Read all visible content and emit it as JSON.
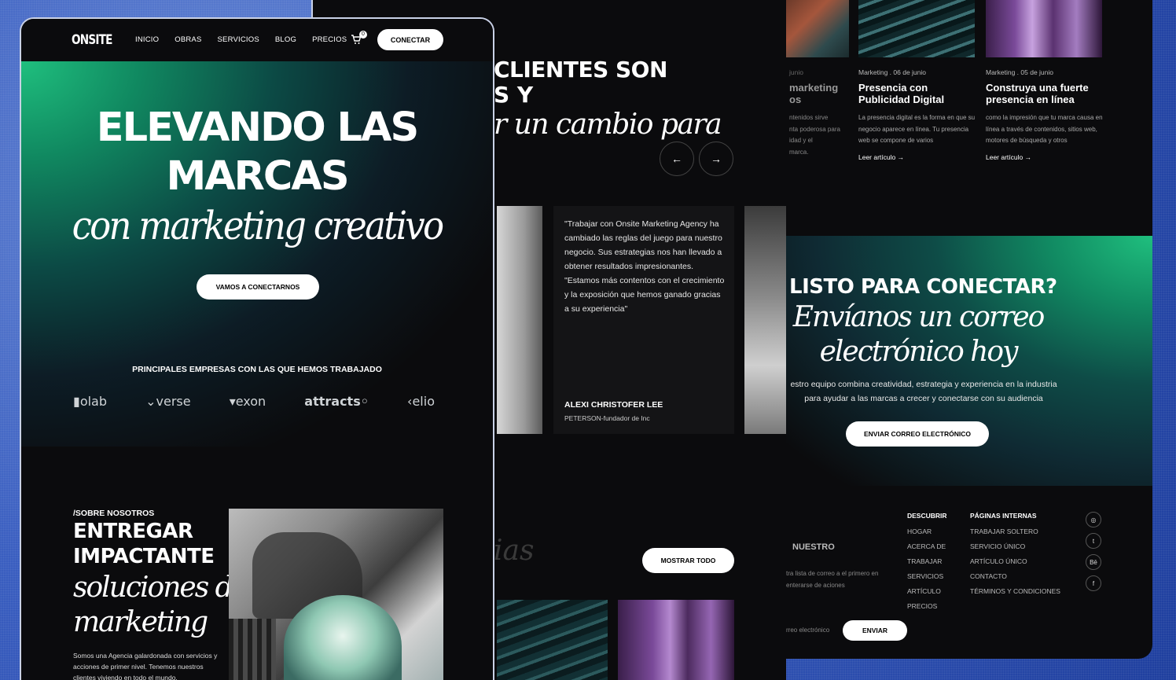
{
  "left": {
    "logo": "ONSITE",
    "menu": [
      "INICIO",
      "OBRAS",
      "SERVICIOS",
      "BLOG",
      "PRECIOS"
    ],
    "cart_count": "0",
    "connect_button": "CONECTAR",
    "hero_line1": "ELEVANDO LAS",
    "hero_line2": "MARCAS",
    "hero_script": "con marketing creativo",
    "hero_cta": "VAMOS A CONECTARNOS",
    "companies_title": "PRINCIPALES EMPRESAS CON LAS QUE HEMOS TRABAJADO",
    "brands": [
      "olab",
      "verse",
      "exon",
      "attracts",
      "elio"
    ],
    "about_label": "/SOBRE NOSOTROS",
    "about_title_1": "ENTREGAR",
    "about_title_2": "IMPACTANTE",
    "about_script_1": "soluciones de",
    "about_script_2": "marketing",
    "about_body": "Somos una Agencia galardonada con servicios y acciones de primer nivel. Tenemos nuestros clientes viviendo en todo el mundo."
  },
  "middle": {
    "title_1": "CLIENTES SON",
    "title_2": "S Y",
    "title_3": "r un cambio para",
    "prev_icon": "arrow-left-icon",
    "next_icon": "arrow-right-icon",
    "quote": "\"Trabajar con Onsite Marketing Agency ha cambiado las reglas del juego para nuestro negocio. Sus estrategias nos han llevado a obtener resultados impresionantes. \"Estamos más contentos con el crecimiento y la exposición que hemos ganado gracias a su experiencia\"",
    "author": "ALEXI CHRISTOFER LEE",
    "role": "PETERSON-fundador de Inc",
    "faded_script": "ias",
    "show_all": "MOSTRAR TODO"
  },
  "right": {
    "frag_meta": "junio",
    "frag_title_1": "marketing",
    "frag_title_2": "os",
    "frag_body": [
      "ntenidos sirve",
      "nta poderosa para",
      "idad y el",
      "marca."
    ],
    "posts": [
      {
        "meta": "Marketing . 06 de junio",
        "title": "Presencia con Publicidad Digital",
        "body": "La presencia digital es la forma en que su negocio aparece en línea. Tu presencia web se compone de varios",
        "read": "Leer artículo"
      },
      {
        "meta": "Marketing . 05 de junio",
        "title": "Construya una fuerte presencia en línea",
        "body": "como la impresión que tu marca causa en línea a través de contenidos, sitios web, motores de búsqueda y otros",
        "read": "Leer artículo"
      }
    ],
    "cta_title": "LISTO PARA CONECTAR?",
    "cta_script_1": "Envíanos un correo",
    "cta_script_2": "electrónico hoy",
    "cta_body_1": "estro equipo combina creatividad, estrategia y experiencia en la industria",
    "cta_body_2": "para ayudar a las marcas a crecer y conectarse con su audiencia",
    "cta_button": "ENVIAR CORREO ELECTRÓNICO",
    "newsletter_title": "NUESTRO",
    "newsletter_body": "tra lista de correo a el primero en enterarse de aciones",
    "email_placeholder": "rreo electrónico",
    "send_button": "ENVIAR",
    "discover_title": "DESCUBRIR",
    "discover_links": [
      "HOGAR",
      "ACERCA DE",
      "TRABAJAR",
      "SERVICIOS",
      "ARTÍCULO",
      "PRECIOS"
    ],
    "pages_title": "PÁGINAS INTERNAS",
    "pages_links": [
      "TRABAJAR SOLTERO",
      "SERVICIO ÚNICO",
      "ARTÍCULO ÚNICO",
      "CONTACTO",
      "TÉRMINOS Y CONDICIONES"
    ],
    "social": [
      "dribbble-icon",
      "twitter-icon",
      "behance-icon",
      "facebook-icon"
    ]
  }
}
